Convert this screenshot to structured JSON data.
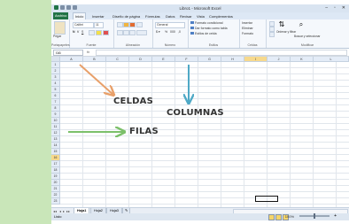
{
  "window": {
    "title": "Libro1 - Microsoft Excel",
    "controls": [
      "–",
      "▫",
      "✕"
    ]
  },
  "tabs": [
    "Archivo",
    "Inicio",
    "Insertar",
    "Diseño de página",
    "Fórmulas",
    "Datos",
    "Revisar",
    "Vista",
    "Complementos"
  ],
  "ribbon": {
    "paste_label": "Pegar",
    "font_name": "Calibri",
    "font_size": "11",
    "number_format": "General",
    "cond_format": "Formato condicional",
    "table_format": "Dar formato como tabla",
    "cell_styles": "Estilos de celda",
    "insert": "Insertar",
    "delete": "Eliminar",
    "format": "Formato",
    "sort": "Ordenar y filtrar",
    "find": "Buscar y seleccionar",
    "group_labels": [
      "Portapapeles",
      "Fuente",
      "Alineación",
      "Número",
      "Estilos",
      "Celdas",
      "Modificar"
    ]
  },
  "formula_bar": {
    "name_box": "I16",
    "fx": "fx",
    "value": ""
  },
  "columns": [
    "A",
    "B",
    "C",
    "D",
    "E",
    "F",
    "G",
    "H",
    "I",
    "J",
    "K",
    "L"
  ],
  "selected_column": "I",
  "rows": [
    "1",
    "2",
    "3",
    "4",
    "5",
    "6",
    "7",
    "8",
    "9",
    "10",
    "11",
    "12",
    "13",
    "14",
    "15",
    "16",
    "17",
    "18",
    "19",
    "20",
    "21",
    "22",
    "23"
  ],
  "selected_row": "16",
  "sheets": [
    "Hoja1",
    "Hoja2",
    "Hoja3"
  ],
  "active_sheet": "Hoja1",
  "status": {
    "mode": "Listo",
    "zoom": "100%"
  },
  "annotations": {
    "cells": "CELDAS",
    "columns": "COLUMNAS",
    "rows": "FILAS"
  },
  "colors": {
    "arrow_orange": "#e8a06a",
    "arrow_blue": "#4fa9c6",
    "arrow_green": "#7cc06a",
    "file_tab": "#217346",
    "selection": "#f7d98c"
  }
}
